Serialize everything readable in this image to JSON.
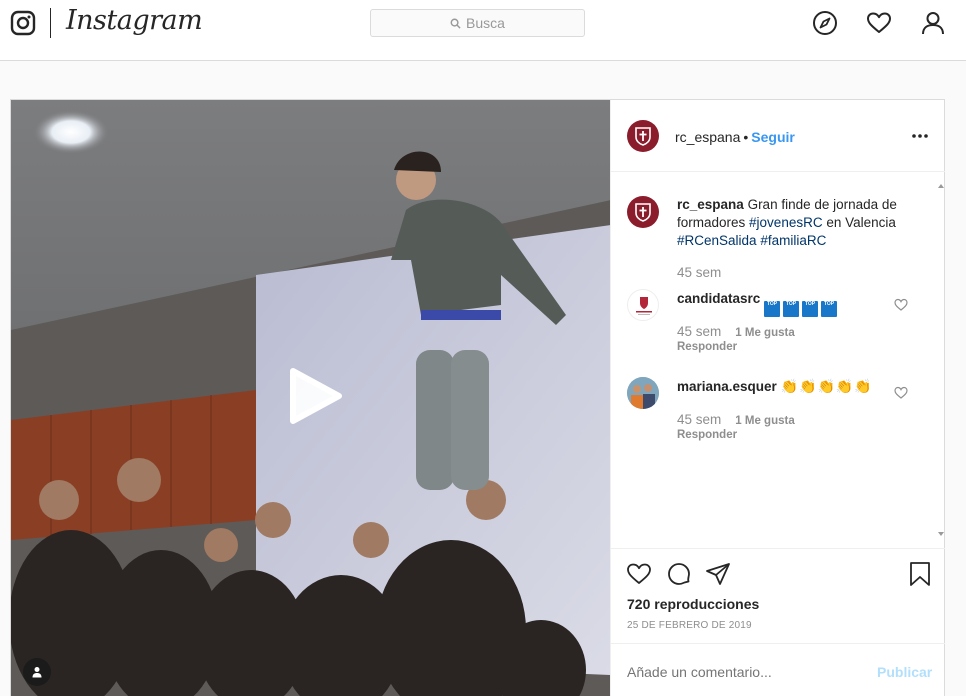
{
  "nav": {
    "brand": "Instagram",
    "search_placeholder": "Busca"
  },
  "post": {
    "author": "rc_espana",
    "follow_label": "Seguir",
    "caption": {
      "username": "rc_espana",
      "text_plain_1": "Gran finde de jornada de formadores",
      "hashtags": [
        "#jovenesRC",
        "#RCenSalida",
        "#familiaRC"
      ],
      "text_plain_2": "en Valencia",
      "time": "45 sem"
    },
    "comments": [
      {
        "username": "candidatasrc",
        "badges": [
          "TOP",
          "TOP",
          "TOP",
          "TOP"
        ],
        "time": "45 sem",
        "likes": "1 Me gusta",
        "reply_label": "Responder"
      },
      {
        "username": "mariana.esquer",
        "emoji": [
          "👏",
          "👏",
          "👏",
          "👏",
          "👏"
        ],
        "time": "45 sem",
        "likes": "1 Me gusta",
        "reply_label": "Responder"
      }
    ],
    "views": "720 reproducciones",
    "date": "25 DE FEBRERO DE 2019",
    "comment_placeholder": "Añade un comentario...",
    "publish_label": "Publicar"
  },
  "colors": {
    "accent": "#3897f0",
    "brand_avatar": "#8a1c2b",
    "hashtag": "#003569",
    "muted": "#8e8e8e"
  }
}
